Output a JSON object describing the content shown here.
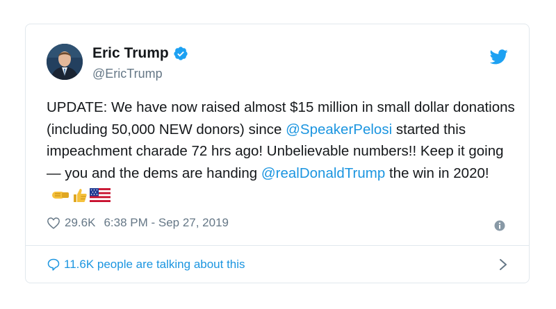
{
  "author": {
    "name": "Eric Trump",
    "handle": "@EricTrump",
    "verified": true
  },
  "tweet": {
    "text_1": "UPDATE: We have now raised almost $15 million in small dollar donations (including 50,000 NEW donors) since ",
    "mention_1": "@SpeakerPelosi",
    "text_2": " started this impeachment charade 72 hrs ago! Unbelievable numbers!! Keep it going — you and the dems are handing ",
    "mention_2": "@realDonaldTrump",
    "text_3": " the win in 2020!",
    "emojis": [
      "left-facing-fist-emoji",
      "thumbs-up-emoji",
      "us-flag-emoji"
    ]
  },
  "meta": {
    "likes": "29.6K",
    "timestamp": "6:38 PM - Sep 27, 2019"
  },
  "footer": {
    "talking": "11.6K people are talking about this"
  },
  "colors": {
    "link": "#1b95e0",
    "text": "#14171a",
    "muted": "#657786",
    "border": "#e1e8ed"
  }
}
